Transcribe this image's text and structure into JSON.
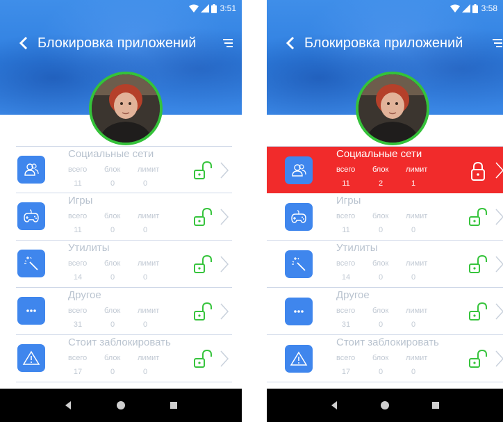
{
  "screens": [
    {
      "status": {
        "time": "3:51"
      },
      "header": {
        "title": "Блокировка приложений"
      },
      "labels": {
        "total": "всего",
        "blocked": "блок",
        "limit": "лимит"
      },
      "rows": [
        {
          "name": "Социальные сети",
          "icon": "contacts-icon",
          "total": "11",
          "blocked": "0",
          "limit": "0",
          "locked": false
        },
        {
          "name": "Игры",
          "icon": "gamepad-icon",
          "total": "11",
          "blocked": "0",
          "limit": "0",
          "locked": false
        },
        {
          "name": "Утилиты",
          "icon": "magic-wand-icon",
          "total": "14",
          "blocked": "0",
          "limit": "0",
          "locked": false
        },
        {
          "name": "Другое",
          "icon": "more-icon",
          "total": "31",
          "blocked": "0",
          "limit": "0",
          "locked": false
        },
        {
          "name": "Стоит заблокировать",
          "icon": "warning-icon",
          "total": "17",
          "blocked": "0",
          "limit": "0",
          "locked": false
        }
      ]
    },
    {
      "status": {
        "time": "3:58"
      },
      "header": {
        "title": "Блокировка приложений"
      },
      "labels": {
        "total": "всего",
        "blocked": "блок",
        "limit": "лимит"
      },
      "rows": [
        {
          "name": "Социальные сети",
          "icon": "contacts-icon",
          "total": "11",
          "blocked": "2",
          "limit": "1",
          "locked": true
        },
        {
          "name": "Игры",
          "icon": "gamepad-icon",
          "total": "11",
          "blocked": "0",
          "limit": "0",
          "locked": false
        },
        {
          "name": "Утилиты",
          "icon": "magic-wand-icon",
          "total": "14",
          "blocked": "0",
          "limit": "0",
          "locked": false
        },
        {
          "name": "Другое",
          "icon": "more-icon",
          "total": "31",
          "blocked": "0",
          "limit": "0",
          "locked": false
        },
        {
          "name": "Стоит заблокировать",
          "icon": "warning-icon",
          "total": "17",
          "blocked": "0",
          "limit": "0",
          "locked": false
        }
      ]
    }
  ],
  "colors": {
    "header_blue": "#2f7fe0",
    "icon_blue": "#3f86ed",
    "unlocked_green": "#37c43d",
    "active_red": "#f12b2b",
    "avatar_ring": "#35c23a"
  }
}
